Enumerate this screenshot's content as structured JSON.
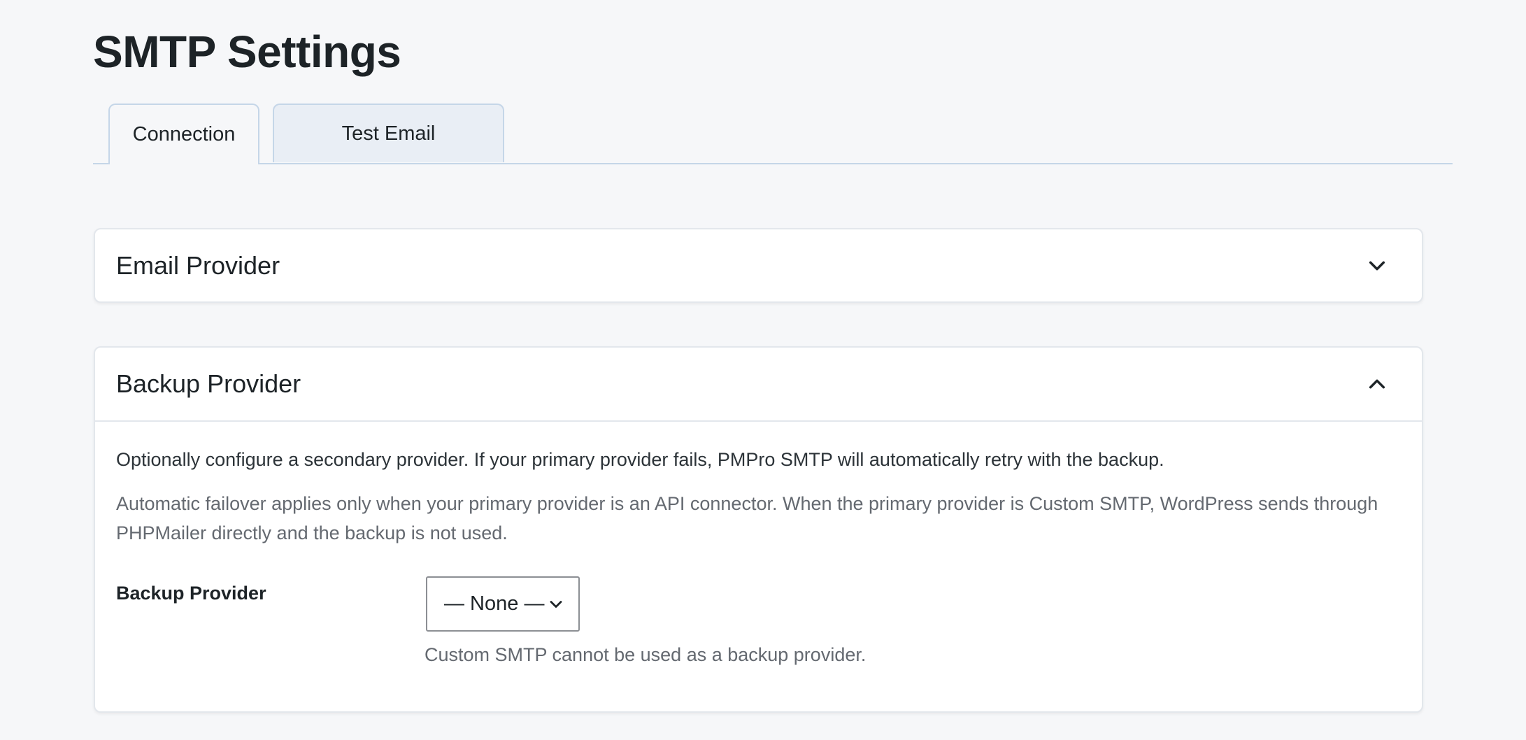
{
  "page": {
    "title": "SMTP Settings"
  },
  "tabs": [
    {
      "label": "Connection",
      "active": true
    },
    {
      "label": "Test Email",
      "active": false
    }
  ],
  "sections": {
    "email_provider": {
      "title": "Email Provider",
      "expanded": false,
      "icon": "chevron-down-icon"
    },
    "backup_provider": {
      "title": "Backup Provider",
      "expanded": true,
      "icon": "chevron-up-icon",
      "description": "Optionally configure a secondary provider. If your primary provider fails, PMPro SMTP will automatically retry with the backup.",
      "note": "Automatic failover applies only when your primary provider is an API connector. When the primary provider is Custom SMTP, WordPress sends through PHPMailer directly and the backup is not used.",
      "field": {
        "label": "Backup Provider",
        "selected": "— None —",
        "help": "Custom SMTP cannot be used as a backup provider."
      }
    }
  },
  "colors": {
    "background": "#f6f7f9",
    "card": "#ffffff",
    "tab_border": "#c5d6e8",
    "inactive_tab": "#e9eef5",
    "text": "#1d2327",
    "muted_text": "#646970"
  }
}
